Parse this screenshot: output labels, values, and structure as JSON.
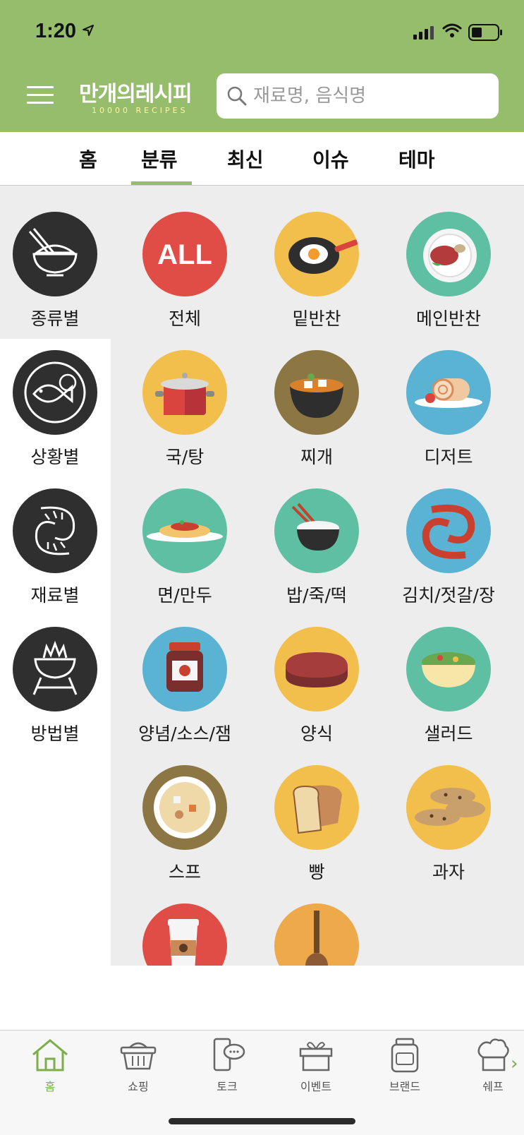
{
  "status_bar": {
    "time": "1:20"
  },
  "header": {
    "logo_main": "만개의레시피",
    "logo_sub": "10000 RECIPES",
    "search_placeholder": "재료명, 음식명"
  },
  "tabs": [
    {
      "label": "홈"
    },
    {
      "label": "분류",
      "active": true
    },
    {
      "label": "최신"
    },
    {
      "label": "이슈"
    },
    {
      "label": "테마"
    }
  ],
  "sidebar": [
    {
      "label": "종류별",
      "icon": "rice-bowl-icon",
      "selected": true
    },
    {
      "label": "상황별",
      "icon": "fish-plate-icon"
    },
    {
      "label": "재료별",
      "icon": "shrimp-icon"
    },
    {
      "label": "방법별",
      "icon": "grill-icon"
    }
  ],
  "categories": [
    {
      "label": "전체",
      "icon_text": "ALL",
      "color": "#e04d47"
    },
    {
      "label": "밑반찬",
      "color": "#f3bf4c"
    },
    {
      "label": "메인반찬",
      "color": "#5fbfa3"
    },
    {
      "label": "국/탕",
      "color": "#f3bf4c"
    },
    {
      "label": "찌개",
      "color": "#8c7643"
    },
    {
      "label": "디저트",
      "color": "#5ab3d3"
    },
    {
      "label": "면/만두",
      "color": "#5fbfa3"
    },
    {
      "label": "밥/죽/떡",
      "color": "#5fbfa3"
    },
    {
      "label": "김치/젓갈/장",
      "color": "#5ab3d3"
    },
    {
      "label": "양념/소스/잼",
      "color": "#5ab3d3"
    },
    {
      "label": "양식",
      "color": "#f3bf4c"
    },
    {
      "label": "샐러드",
      "color": "#5fbfa3"
    },
    {
      "label": "스프",
      "color": "#8c7643"
    },
    {
      "label": "빵",
      "color": "#f3bf4c"
    },
    {
      "label": "과자",
      "color": "#f3bf4c"
    },
    {
      "label": "",
      "color": "#e04d47"
    },
    {
      "label": "",
      "color": "#eda94a"
    }
  ],
  "bottom_nav": [
    {
      "label": "홈",
      "icon": "home-icon",
      "active": true
    },
    {
      "label": "쇼핑",
      "icon": "basket-icon"
    },
    {
      "label": "토크",
      "icon": "chat-phone-icon"
    },
    {
      "label": "이벤트",
      "icon": "gift-icon"
    },
    {
      "label": "브랜드",
      "icon": "jar-icon"
    },
    {
      "label": "쉐프",
      "icon": "chef-hat-icon"
    }
  ],
  "colors": {
    "brand_green": "#95bd6b",
    "active_green": "#7cae4c"
  }
}
